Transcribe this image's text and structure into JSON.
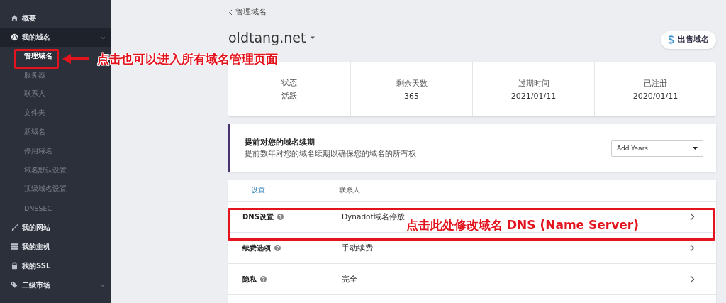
{
  "sidebar": {
    "items": [
      {
        "label": "概要"
      },
      {
        "label": "我的域名",
        "expanded": true,
        "children": [
          {
            "label": "管理域名",
            "selected": true
          },
          {
            "label": "服务器",
            "selected": false
          },
          {
            "label": "联系人",
            "selected": false
          },
          {
            "label": "文件夹",
            "selected": false
          },
          {
            "label": "新域名",
            "selected": false
          },
          {
            "label": "停用域名",
            "selected": false
          },
          {
            "label": "域名默认设置",
            "selected": false
          },
          {
            "label": "顶级域名设置",
            "selected": false
          },
          {
            "label": "DNSSEC",
            "selected": false
          }
        ]
      },
      {
        "label": "我的网站"
      },
      {
        "label": "我的主机"
      },
      {
        "label": "我的SSL"
      },
      {
        "label": "二级市场",
        "expanded": false
      }
    ]
  },
  "back_link": "管理域名",
  "domain": "oldtang.net",
  "sell_button": "出售域名",
  "stats": [
    {
      "label": "状态",
      "value": "活跃"
    },
    {
      "label": "剩余天数",
      "value": "365"
    },
    {
      "label": "过期时间",
      "value": "2021/01/11"
    },
    {
      "label": "已注册",
      "value": "2020/01/11"
    }
  ],
  "renewal": {
    "title": "提前对您的域名续期",
    "description": "提前数年对您的域名续期以确保您的域名的所有权",
    "select": "Add Years"
  },
  "tabs": [
    {
      "label": "设置",
      "selected": true
    },
    {
      "label": "联系人",
      "selected": false
    }
  ],
  "settings": [
    {
      "label": "DNS设置",
      "value": "Dynadot域名停放"
    },
    {
      "label": "续费选项",
      "value": "手动续费"
    },
    {
      "label": "隐私",
      "value": "完全"
    }
  ],
  "annotations": [
    {
      "kind": "sidebar",
      "text": "点击也可以进入所有域名管理页面"
    },
    {
      "kind": "dns",
      "text": "点击此处修改域名 DNS (Name Server)"
    }
  ]
}
